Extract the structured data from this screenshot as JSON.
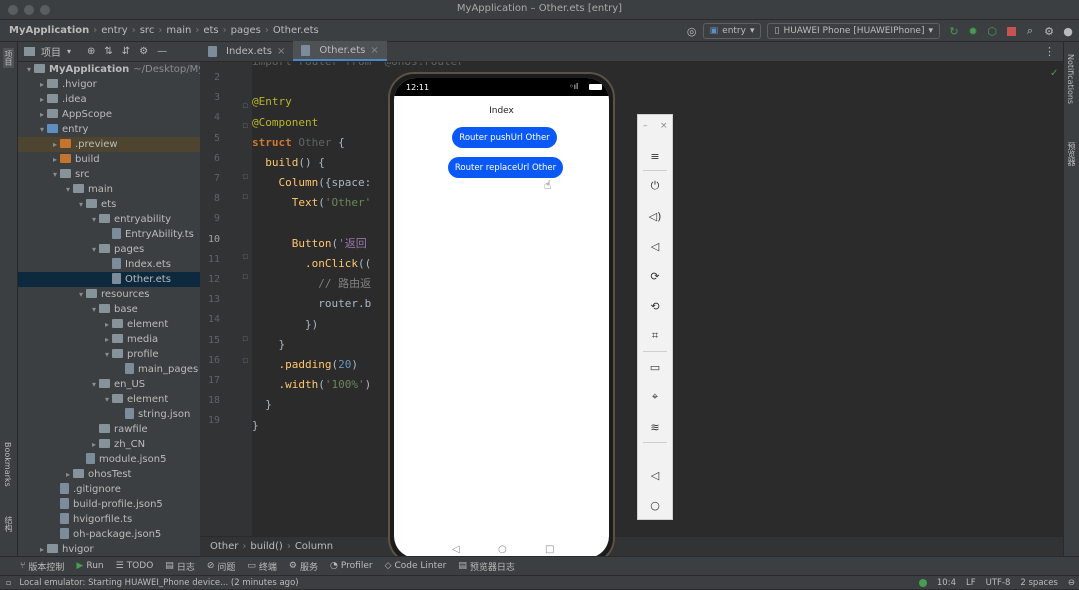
{
  "window": {
    "title": "MyApplication – Other.ets [entry]"
  },
  "breadcrumbs": [
    "MyApplication",
    "entry",
    "src",
    "main",
    "ets",
    "pages",
    "Other.ets"
  ],
  "run_config": "entry",
  "device": "HUAWEI Phone [HUAWEIPhone]",
  "left_strip": {
    "project": "项目",
    "bookmarks": "Bookmarks",
    "structure": "结构"
  },
  "right_strip": {
    "notifications": "Notifications",
    "previewer": "预览器"
  },
  "project_panel": {
    "title": "项目",
    "tree": [
      {
        "label": "MyApplication",
        "suffix": "~/Desktop/MyA",
        "depth": 0,
        "arrow": "▾",
        "kind": "folder"
      },
      {
        "label": ".hvigor",
        "depth": 1,
        "arrow": "▸",
        "kind": "folder"
      },
      {
        "label": ".idea",
        "depth": 1,
        "arrow": "▸",
        "kind": "folder"
      },
      {
        "label": "AppScope",
        "depth": 1,
        "arrow": "▸",
        "kind": "folder"
      },
      {
        "label": "entry",
        "depth": 1,
        "arrow": "▾",
        "kind": "folder-blue"
      },
      {
        "label": ".preview",
        "depth": 2,
        "arrow": "▸",
        "kind": "folder-orange",
        "highlight": true
      },
      {
        "label": "build",
        "depth": 2,
        "arrow": "▸",
        "kind": "folder-orange"
      },
      {
        "label": "src",
        "depth": 2,
        "arrow": "▾",
        "kind": "folder"
      },
      {
        "label": "main",
        "depth": 3,
        "arrow": "▾",
        "kind": "folder"
      },
      {
        "label": "ets",
        "depth": 4,
        "arrow": "▾",
        "kind": "folder"
      },
      {
        "label": "entryability",
        "depth": 5,
        "arrow": "▾",
        "kind": "folder"
      },
      {
        "label": "EntryAbility.ts",
        "depth": 6,
        "arrow": "",
        "kind": "file"
      },
      {
        "label": "pages",
        "depth": 5,
        "arrow": "▾",
        "kind": "folder"
      },
      {
        "label": "Index.ets",
        "depth": 6,
        "arrow": "",
        "kind": "file"
      },
      {
        "label": "Other.ets",
        "depth": 6,
        "arrow": "",
        "kind": "file",
        "selected": true
      },
      {
        "label": "resources",
        "depth": 4,
        "arrow": "▾",
        "kind": "folder"
      },
      {
        "label": "base",
        "depth": 5,
        "arrow": "▾",
        "kind": "folder"
      },
      {
        "label": "element",
        "depth": 6,
        "arrow": "▸",
        "kind": "folder"
      },
      {
        "label": "media",
        "depth": 6,
        "arrow": "▸",
        "kind": "folder"
      },
      {
        "label": "profile",
        "depth": 6,
        "arrow": "▾",
        "kind": "folder"
      },
      {
        "label": "main_pages",
        "depth": 7,
        "arrow": "",
        "kind": "file"
      },
      {
        "label": "en_US",
        "depth": 5,
        "arrow": "▾",
        "kind": "folder"
      },
      {
        "label": "element",
        "depth": 6,
        "arrow": "▾",
        "kind": "folder"
      },
      {
        "label": "string.json",
        "depth": 7,
        "arrow": "",
        "kind": "file"
      },
      {
        "label": "rawfile",
        "depth": 5,
        "arrow": "",
        "kind": "folder"
      },
      {
        "label": "zh_CN",
        "depth": 5,
        "arrow": "▸",
        "kind": "folder"
      },
      {
        "label": "module.json5",
        "depth": 4,
        "arrow": "",
        "kind": "file"
      },
      {
        "label": "ohosTest",
        "depth": 3,
        "arrow": "▸",
        "kind": "folder"
      },
      {
        "label": ".gitignore",
        "depth": 2,
        "arrow": "",
        "kind": "file"
      },
      {
        "label": "build-profile.json5",
        "depth": 2,
        "arrow": "",
        "kind": "file"
      },
      {
        "label": "hvigorfile.ts",
        "depth": 2,
        "arrow": "",
        "kind": "file"
      },
      {
        "label": "oh-package.json5",
        "depth": 2,
        "arrow": "",
        "kind": "file"
      },
      {
        "label": "hvigor",
        "depth": 1,
        "arrow": "▸",
        "kind": "folder"
      }
    ]
  },
  "editor": {
    "tabs": [
      {
        "label": "Index.ets",
        "active": false
      },
      {
        "label": "Other.ets",
        "active": true
      }
    ],
    "line_numbers": [
      "2",
      "3",
      "4",
      "5",
      "6",
      "7",
      "8",
      "9",
      "10",
      "11",
      "12",
      "13",
      "14",
      "15",
      "16",
      "17",
      "18",
      "19"
    ],
    "current_line": "10",
    "code_lines": [
      [
        {
          "t": "import router from '@ohos.router'",
          "c": "dim"
        }
      ],
      [],
      [
        {
          "t": "@Entry",
          "c": "ann"
        }
      ],
      [
        {
          "t": "@Component",
          "c": "ann"
        }
      ],
      [
        {
          "t": "struct ",
          "c": "kw"
        },
        {
          "t": "Other ",
          "c": "dim"
        },
        {
          "t": "{",
          "c": "id"
        }
      ],
      [
        {
          "t": "  build",
          "c": "fn"
        },
        {
          "t": "() {",
          "c": "id"
        }
      ],
      [
        {
          "t": "    Column",
          "c": "fn"
        },
        {
          "t": "({",
          "c": "id"
        },
        {
          "t": "space:",
          "c": "id"
        }
      ],
      [
        {
          "t": "      Text",
          "c": "fn"
        },
        {
          "t": "(",
          "c": "id"
        },
        {
          "t": "'Other'",
          "c": "str"
        }
      ],
      [],
      [
        {
          "t": "      Button",
          "c": "fn"
        },
        {
          "t": "(",
          "c": "id"
        },
        {
          "t": "'返回",
          "c": "prop"
        }
      ],
      [
        {
          "t": "        .onClick",
          "c": "fn"
        },
        {
          "t": "((",
          "c": "id"
        }
      ],
      [
        {
          "t": "          // 路由返",
          "c": "cmt"
        }
      ],
      [
        {
          "t": "          router.b",
          "c": "id"
        }
      ],
      [
        {
          "t": "        })",
          "c": "id"
        }
      ],
      [
        {
          "t": "    }",
          "c": "id"
        }
      ],
      [
        {
          "t": "    .padding",
          "c": "fn"
        },
        {
          "t": "(",
          "c": "id"
        },
        {
          "t": "20",
          "c": "num"
        },
        {
          "t": ")",
          "c": "id"
        }
      ],
      [
        {
          "t": "    .width",
          "c": "fn"
        },
        {
          "t": "(",
          "c": "id"
        },
        {
          "t": "'100%'",
          "c": "str"
        },
        {
          "t": ")",
          "c": "id"
        }
      ],
      [
        {
          "t": "  }",
          "c": "id"
        }
      ],
      [
        {
          "t": "}",
          "c": "id"
        }
      ]
    ],
    "breadcrumb": [
      "Other",
      "build()",
      "Column"
    ]
  },
  "previewer": {
    "time": "12:11",
    "page_title": "Index",
    "buttons": [
      "Router pushUrl Other",
      "Router replaceUrl Other"
    ]
  },
  "emulator_panel": {
    "icons": [
      "menu-icon",
      "power-icon",
      "volume-down-icon",
      "volume-mute-icon",
      "rotate-right-icon",
      "rotate-left-icon",
      "crop-icon",
      "battery-icon",
      "location-icon",
      "wifi-icon",
      "back-icon",
      "home-icon"
    ]
  },
  "bottom_toolbar": [
    {
      "icon": "version-control-icon",
      "label": "版本控制"
    },
    {
      "icon": "run-icon",
      "label": "Run"
    },
    {
      "icon": "todo-icon",
      "label": "TODO"
    },
    {
      "icon": "log-icon",
      "label": "日志"
    },
    {
      "icon": "problems-icon",
      "label": "问题"
    },
    {
      "icon": "terminal-icon",
      "label": "终端"
    },
    {
      "icon": "services-icon",
      "label": "服务"
    },
    {
      "icon": "profiler-icon",
      "label": "Profiler"
    },
    {
      "icon": "code-linter-icon",
      "label": "Code Linter"
    },
    {
      "icon": "preview-log-icon",
      "label": "预览器日志"
    }
  ],
  "status_bar": {
    "message": "Local emulator: Starting HUAWEI_Phone device... (2 minutes ago)",
    "position": "10:4",
    "line_sep": "LF",
    "encoding": "UTF-8",
    "indent": "2 spaces"
  },
  "colors": {
    "accent": "#0a59f7",
    "selection": "#0d293e",
    "run_green": "#499c54",
    "stop_red": "#c75450"
  }
}
